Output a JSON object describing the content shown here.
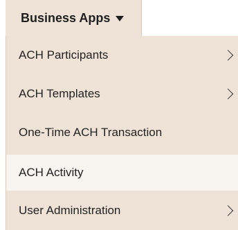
{
  "menu_trigger": {
    "label": "Business Apps",
    "icon": "caret-down-icon"
  },
  "menu": {
    "items": [
      {
        "label": "ACH Participants",
        "has_submenu": true
      },
      {
        "label": "ACH Templates",
        "has_submenu": true
      },
      {
        "label": "One-Time ACH Transaction",
        "has_submenu": false
      },
      {
        "label": "ACH Activity",
        "has_submenu": false,
        "highlighted": true
      },
      {
        "label": "User Administration",
        "has_submenu": true
      }
    ]
  },
  "colors": {
    "menu_background": "#efe3d7",
    "highlight_background": "#f8f4f0",
    "text": "#232323"
  }
}
